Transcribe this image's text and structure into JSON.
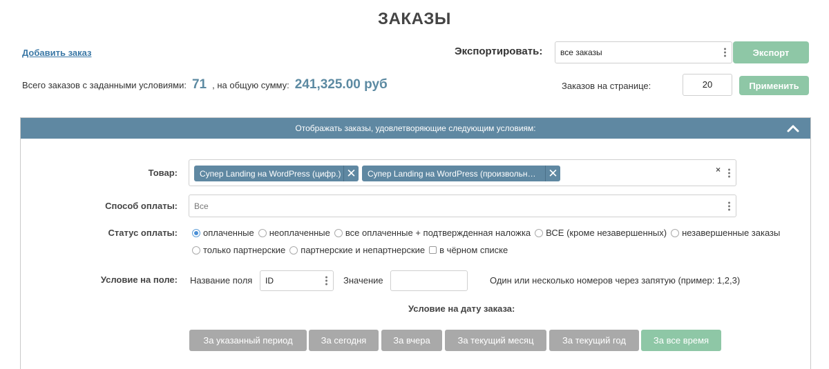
{
  "page": {
    "title": "ЗАКАЗЫ",
    "add_order_link": "Добавить заказ"
  },
  "export": {
    "label": "Экспортировать:",
    "select_value": "все заказы",
    "button": "Экспорт"
  },
  "summary": {
    "total_label": "Всего заказов с заданными условиями:",
    "total_count": "71",
    "sum_label": ", на общую сумму:",
    "sum_value": "241,325.00 руб"
  },
  "per_page": {
    "label": "Заказов на странице:",
    "value": "20",
    "button": "Применить"
  },
  "filter_panel": {
    "header": "Отображать заказы, удовлетворяющие следующим условиям:",
    "product": {
      "label": "Товар:",
      "tags": [
        "Супер Landing на WordPress (цифр.)",
        "Супер Landing на WordPress (произвольн…"
      ]
    },
    "payment_method": {
      "label": "Способ оплаты:",
      "value": "Все"
    },
    "payment_status": {
      "label": "Статус оплаты:",
      "options": [
        "оплаченные",
        "неоплаченные",
        "все оплаченные + подтвержденная наложка",
        "ВСЕ (кроме незавершенных)",
        "незавершенные заказы",
        "только партнерские",
        "партнерские и непартнерские"
      ],
      "selected": "оплаченные",
      "blacklist_checkbox": "в чёрном списке"
    },
    "field_condition": {
      "label": "Условие на поле:",
      "field_name_label": "Название поля",
      "field_name_value": "ID",
      "value_label": "Значение",
      "value": "",
      "hint": "Один или несколько номеров через запятую (пример: 1,2,3)"
    },
    "date_condition": {
      "title": "Условие на дату заказа:",
      "buttons": [
        "За указанный период",
        "За сегодня",
        "За вчера",
        "За текущий месяц",
        "За текущий год",
        "За все время"
      ],
      "active": "За все время"
    }
  },
  "colors": {
    "accent_blue": "#5f88a2",
    "green_button": "#8ec7a6",
    "gray_button": "#a9a9a9",
    "link": "#3b78a6"
  }
}
